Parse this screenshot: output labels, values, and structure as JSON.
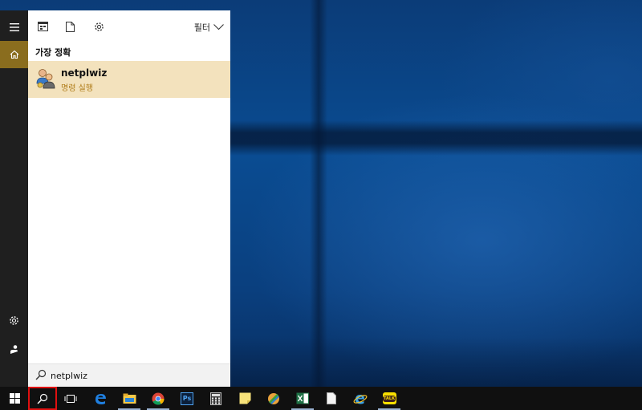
{
  "search_panel": {
    "filter_label": "필터",
    "section_title": "가장 정확",
    "top_result": {
      "title": "netplwiz",
      "subtitle": "명령 실행",
      "icon": "users-accounts-icon"
    },
    "query": "netplwiz",
    "toolbar_icons": [
      "apps-icon",
      "document-icon",
      "settings-icon"
    ]
  },
  "left_rail": {
    "items": [
      "hamburger-menu-icon",
      "home-icon",
      "settings-icon",
      "user-feedback-icon"
    ],
    "active": "home-icon"
  },
  "taskbar": {
    "items": [
      "windows-start-icon",
      "search-icon",
      "task-view-icon",
      "edge-icon",
      "file-explorer-icon",
      "chrome-icon",
      "photoshop-icon",
      "calculator-icon",
      "sticky-notes-icon",
      "color-app-icon",
      "excel-icon",
      "blank-document-icon",
      "internet-explorer-icon",
      "kakaotalk-icon"
    ],
    "highlighted": "search-icon",
    "photoshop_label": "Ps",
    "kakao_label": "TALK"
  },
  "colors": {
    "accent": "#8a6d1e",
    "result_bg": "#f3e2bd",
    "result_sub": "#b07d1a",
    "highlight": "#e01010",
    "taskbar": "#101010"
  }
}
